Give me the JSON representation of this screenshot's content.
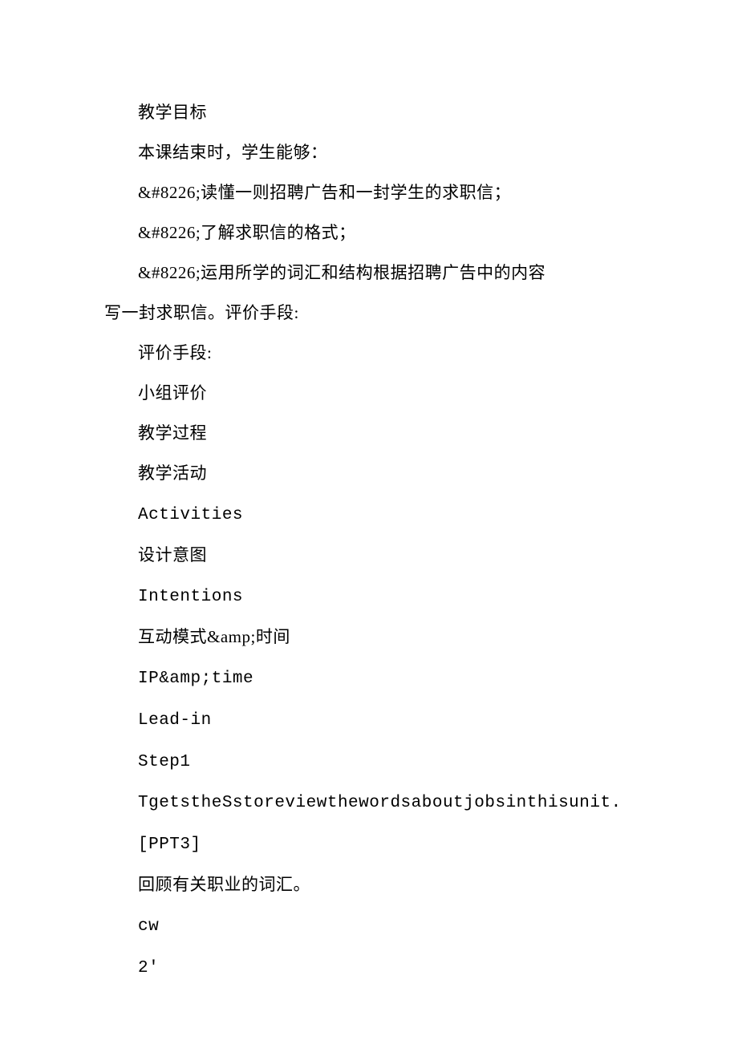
{
  "lines": {
    "l1": "教学目标",
    "l2": "本课结束时，学生能够：",
    "l3": "&#8226;读懂一则招聘广告和一封学生的求职信；",
    "l4": "&#8226;了解求职信的格式；",
    "l5a": "&#8226;运用所学的词汇和结构根据招聘广告中的内容",
    "l5b": "写一封求职信。评价手段:",
    "l6": "评价手段:",
    "l7": "小组评价",
    "l8": "教学过程",
    "l9": "教学活动",
    "l10": "Activities",
    "l11": "设计意图",
    "l12": "Intentions",
    "l13": "互动模式&amp;时间",
    "l14": "IP&amp;time",
    "l15": "Lead-in",
    "l16": "Step1",
    "l17": "TgetstheSstoreviewthewordsaboutjobsinthisunit.",
    "l18": "[PPT3]",
    "l19": "回顾有关职业的词汇。",
    "l20": "cw",
    "l21": "2'"
  }
}
